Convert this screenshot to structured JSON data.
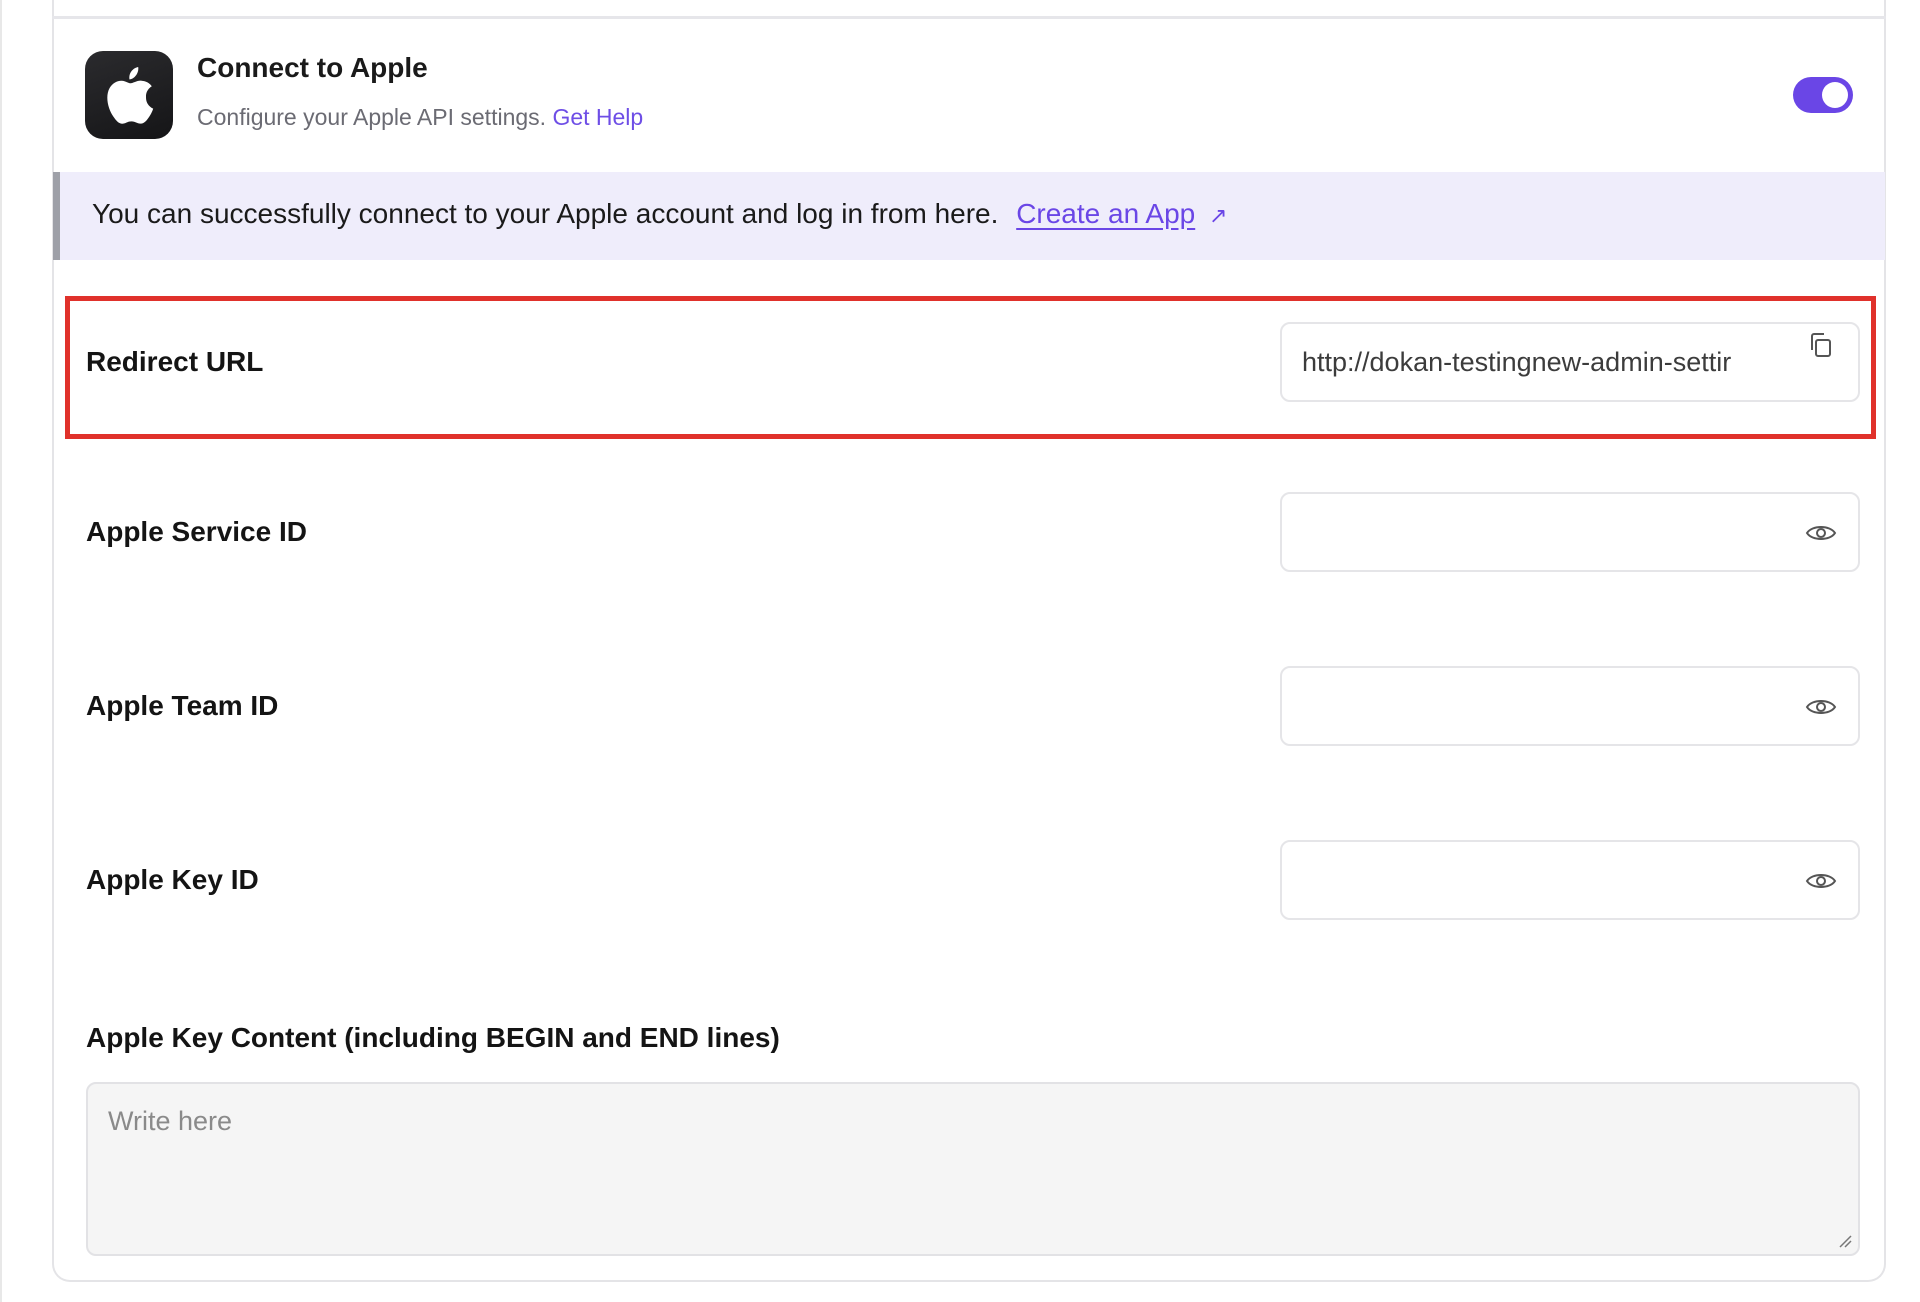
{
  "header": {
    "title": "Connect to Apple",
    "description": "Configure your Apple API settings.",
    "help_link": "Get Help",
    "toggle_enabled": true,
    "accent_color": "#6a46e6"
  },
  "notice": {
    "text": "You can successfully connect to your Apple account and log in from here.",
    "link_label": "Create an App",
    "link_icon": "external-link-arrow-icon"
  },
  "fields": {
    "redirect_url": {
      "label": "Redirect URL",
      "value": "http://dokan-testingnew-admin-settir",
      "icon": "copy-icon"
    },
    "service_id": {
      "label": "Apple Service ID",
      "value": "",
      "icon": "eye-icon"
    },
    "team_id": {
      "label": "Apple Team ID",
      "value": "",
      "icon": "eye-icon"
    },
    "key_id": {
      "label": "Apple Key ID",
      "value": "",
      "icon": "eye-icon"
    },
    "key_content": {
      "label": "Apple Key Content (including BEGIN and END lines)",
      "placeholder": "Write here"
    }
  },
  "highlight_color": "#e0312b"
}
